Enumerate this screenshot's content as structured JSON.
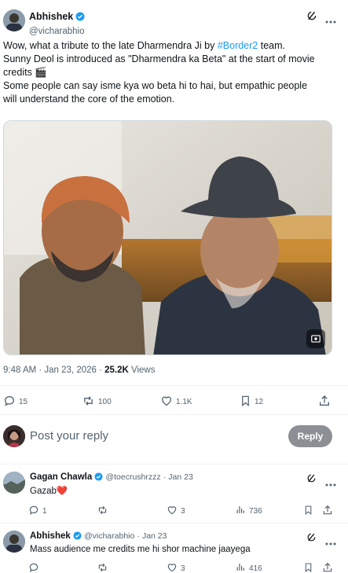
{
  "main_post": {
    "author_name": "Abhishek",
    "author_handle": "@vicharabhio",
    "text_line1_a": "Wow, what a tribute to the late Dharmendra Ji by ",
    "hashtag": "#Border2",
    "text_line1_b": " team.",
    "text_line2": "Sunny Deol is introduced as \"Dharmendra ka Beta\" at the start of movie",
    "text_line3": "credits 🎬",
    "text_line4": "Some people can say isme kya wo beta hi to hai, but empathic people",
    "text_line5": "will understand the core of the emotion.",
    "timestamp": "9:48 AM · Jan 23, 2026 · ",
    "views_count": "25.2K",
    "views_label": " Views",
    "stats": {
      "replies": "15",
      "reposts": "100",
      "likes": "1.1K",
      "bookmarks": "12"
    }
  },
  "reply_composer": {
    "placeholder": "Post your reply",
    "button_label": "Reply"
  },
  "replies": [
    {
      "author_name": "Gagan Chawla",
      "author_handle": "@toecrushrzzz",
      "date": "· Jan 23",
      "text": "Gazab❤️",
      "stats": {
        "replies": "1",
        "reposts": "",
        "likes": "3",
        "views": "736"
      }
    },
    {
      "author_name": "Abhishek",
      "author_handle": "@vicharabhio",
      "date": "· Jan 23",
      "text": "Mass audience me credits me hi shor machine jaayega",
      "stats": {
        "replies": "",
        "reposts": "",
        "likes": "3",
        "views": "416"
      }
    }
  ],
  "colors": {
    "accent": "#1d9bf0",
    "reply_button": "#8c9095",
    "heart": "#e0245e"
  },
  "icons": [
    "verified-badge-icon",
    "grok-icon",
    "more-icon",
    "reply-icon",
    "repost-icon",
    "like-icon",
    "bookmark-icon",
    "share-icon",
    "views-icon",
    "media-settings-icon"
  ]
}
